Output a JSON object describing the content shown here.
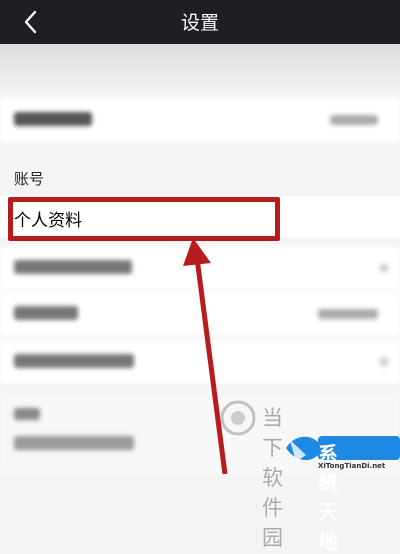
{
  "header": {
    "title": "设置",
    "back_icon": "chevron-left-icon"
  },
  "settings": {
    "section_header": "账号",
    "highlighted_item": "个人资料"
  },
  "annotation": {
    "highlight_color": "#b71c1c",
    "arrow_color": "#b71c1c"
  },
  "watermark": {
    "site_name": "当下软件园",
    "brand_name": "系统天地",
    "url": "XiTongTianDi.net"
  },
  "colors": {
    "topbar": "#1d1f24",
    "background": "#f4f4f4"
  }
}
